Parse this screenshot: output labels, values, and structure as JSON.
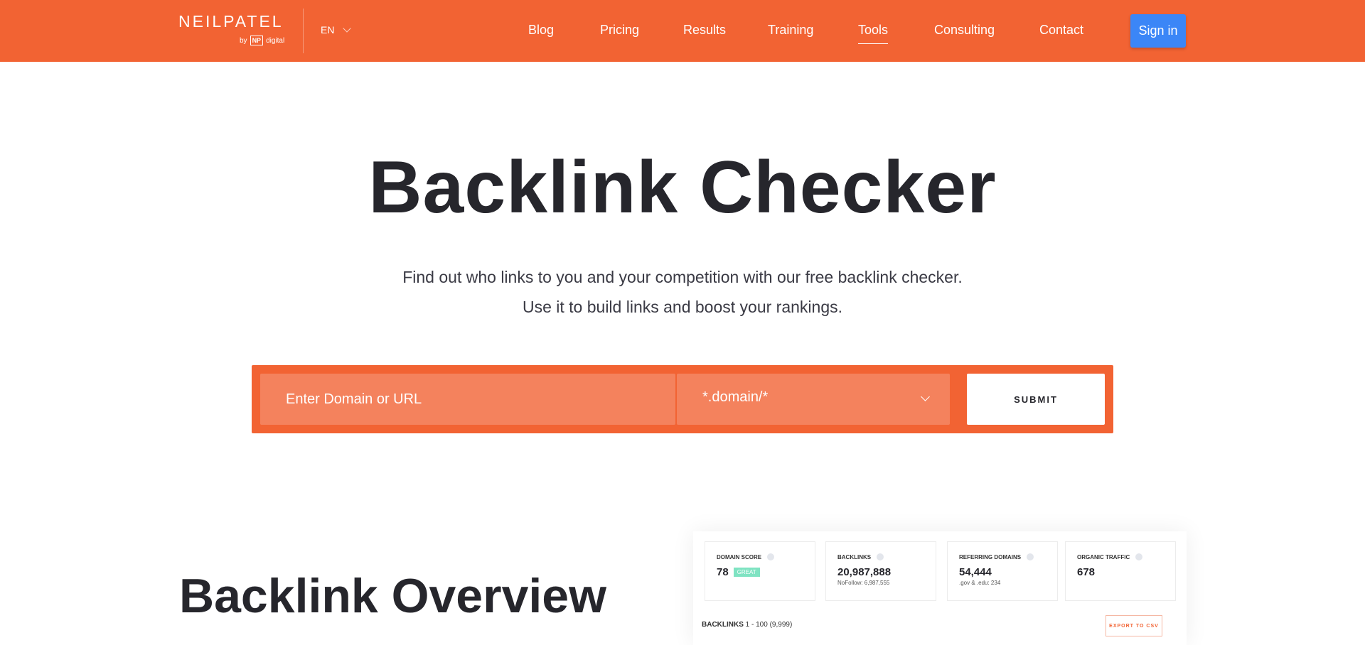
{
  "header": {
    "logo_name": "NEILPATEL",
    "logo_by": "by",
    "logo_np": "NP",
    "logo_digital": "digital",
    "language": "EN",
    "nav": [
      "Blog",
      "Pricing",
      "Results",
      "Training",
      "Tools",
      "Consulting",
      "Contact"
    ],
    "active": "Tools",
    "sign_in": "Sign in"
  },
  "hero": {
    "title": "Backlink Checker",
    "subtitle_line1": "Find out who links to you and your competition with our free backlink checker.",
    "subtitle_line2": "Use it to build links and boost your rankings."
  },
  "search": {
    "placeholder": "Enter Domain or URL",
    "scope_selected": "*.domain/*",
    "submit": "SUBMIT"
  },
  "overview": {
    "heading": "Backlink Overview",
    "cards": [
      {
        "label": "DOMAIN SCORE",
        "value": "78",
        "badge": "GREAT"
      },
      {
        "label": "BACKLINKS",
        "value": "20,987,888",
        "sub": "NoFollow: 6,987,555"
      },
      {
        "label": "REFERRING DOMAINS",
        "value": "54,444",
        "sub": ".gov & .edu: 234"
      },
      {
        "label": "ORGANIC TRAFFIC",
        "value": "678"
      }
    ],
    "backlinks_label": "BACKLINKS",
    "backlinks_range": "1 - 100 (9,999)",
    "export": "EXPORT TO CSV"
  },
  "colors": {
    "brand": "#f26333",
    "input_bg": "#f4825d",
    "sign_in": "#3b86f7",
    "badge": "#7fe3c2"
  }
}
